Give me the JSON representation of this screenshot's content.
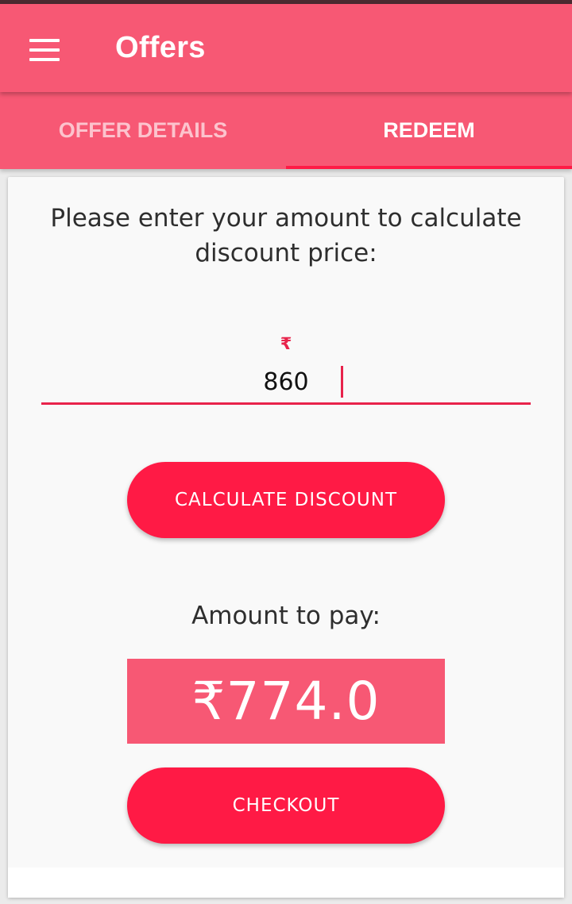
{
  "app_bar": {
    "title": "Offers",
    "menu_icon": "hamburger-menu-icon"
  },
  "tabs": [
    {
      "label": "OFFER DETAILS",
      "selected": false
    },
    {
      "label": "REDEEM",
      "selected": true
    }
  ],
  "redeem": {
    "prompt": "Please enter your amount to calculate discount price:",
    "currency_symbol": "₹",
    "amount_value": "860",
    "calculate_label": "CALCULATE DISCOUNT",
    "amount_to_pay_label": "Amount to pay:",
    "amount_to_pay_value": "₹774.0",
    "checkout_label": "CHECKOUT"
  },
  "colors": {
    "primary": "#f75874",
    "accent": "#ff1a45",
    "text": "#2e2e2e"
  }
}
